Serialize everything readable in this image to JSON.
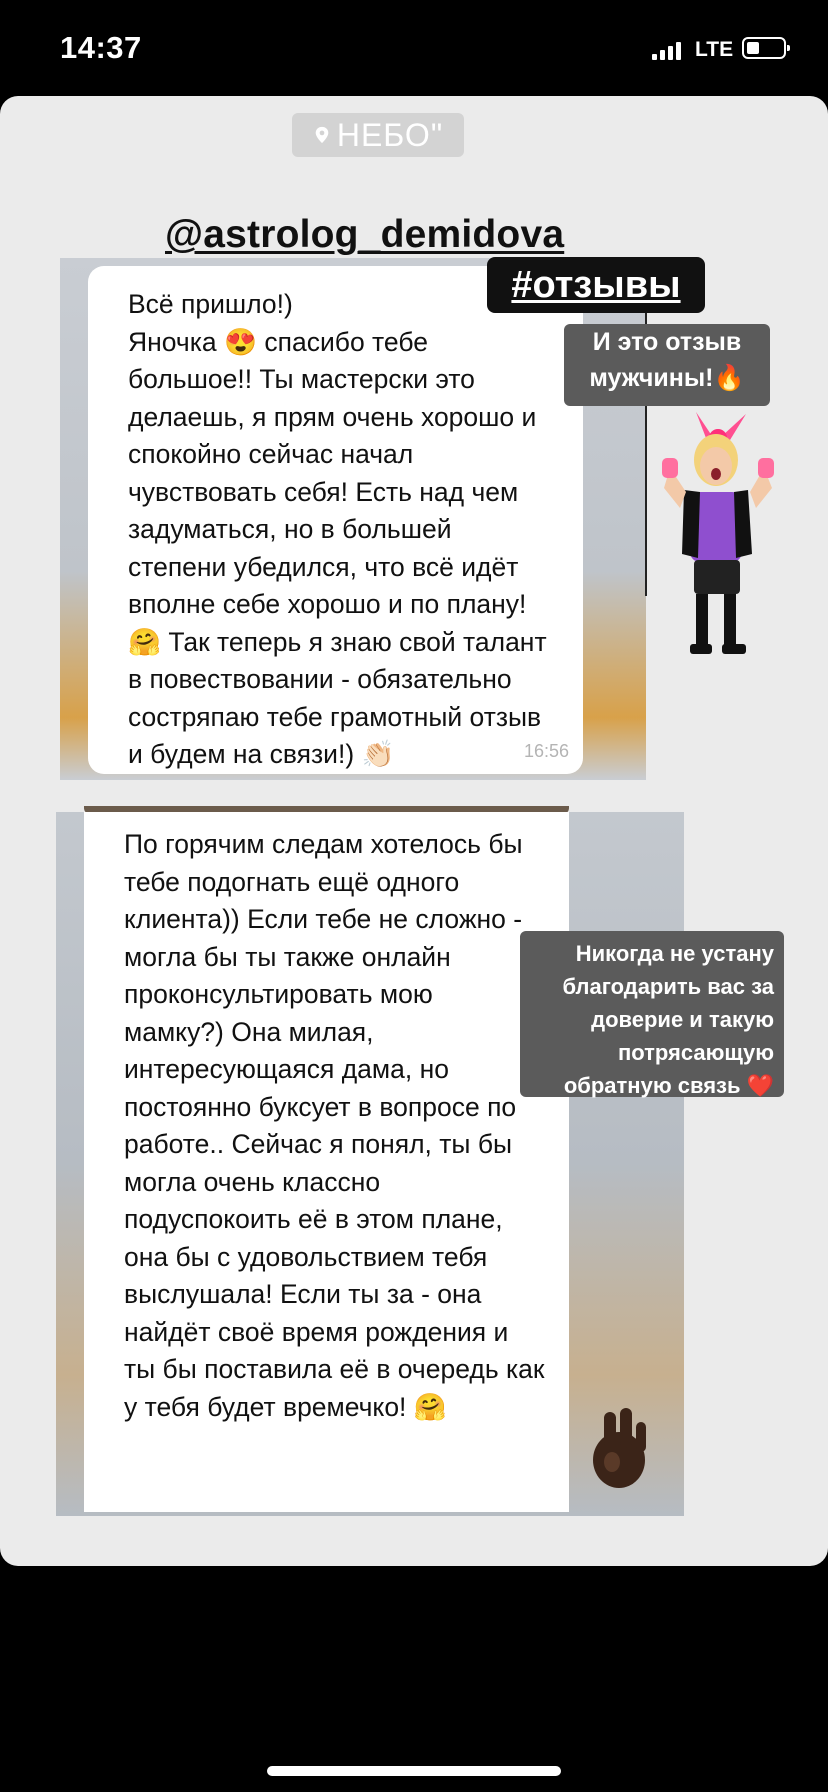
{
  "status_bar": {
    "time": "14:37",
    "network": "LTE"
  },
  "story": {
    "location": "НЕБО\"",
    "handle": "@astrolog_demidova",
    "hashtag": "#отзывы",
    "note_1": "И это отзыв\nмужчины!🔥",
    "note_2": "Никогда не устану\nблагодарить вас за\nдоверие и такую\nпотрясающую\nобратную связь ❤️",
    "message_1": {
      "text": "Всё пришло!)\nЯночка 😍 спасибо тебе\nбольшое!! Ты мастерски это\nделаешь, я прям очень хорошо и\nспокойно сейчас начал\nчувствовать себя! Есть над чем\nзадуматься, но в большей\nстепени убедился, что всё идёт\nвполне себе хорошо и по плану!\n🤗 Так теперь я знаю свой талант\nв повествовании - обязательно\nсостряпаю тебе грамотный отзыв\nи будем на связи!) 👏🏻",
      "time": "16:56"
    },
    "message_2": {
      "text": "По горячим следам хотелось бы\nтебе подогнать ещё одного\nклиента)) Если тебе не сложно -\nмогла бы ты также онлайн\nпроконсультировать мою\nмамку?) Она милая,\nинтересующаяся дама, но\nпостоянно буксует в вопросе по\nработе.. Сейчас я понял, ты бы\nмогла очень классно\nподуспокоить её в этом плане,\nона бы с удовольствием тебя\nвыслушала! Если ты за - она\nнайдёт своё время рождения и\nты бы поставила её в очередь как\nу тебя будет времечко! 🤗"
    }
  }
}
